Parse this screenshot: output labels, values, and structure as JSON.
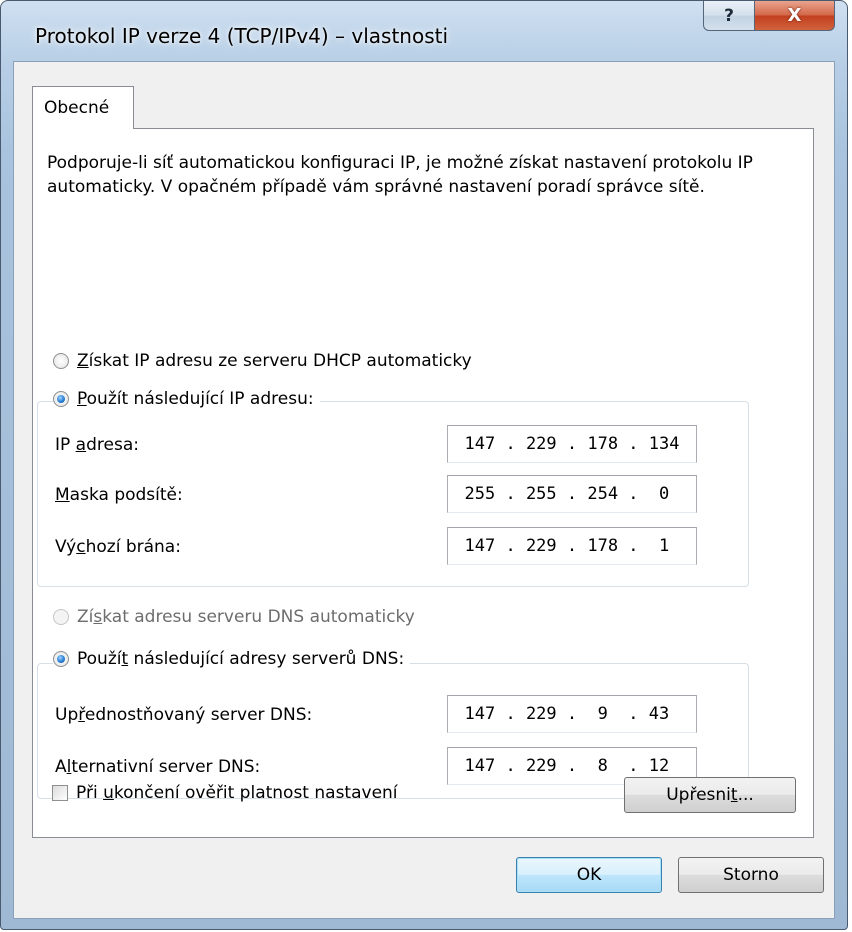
{
  "window": {
    "title": "Protokol IP verze 4 (TCP/IPv4) – vlastnosti",
    "help_glyph": "?",
    "close_glyph": "X"
  },
  "tabs": [
    {
      "label": "Obecné",
      "active": true
    }
  ],
  "description": "Podporuje-li síť automatickou konfiguraci IP, je možné získat nastavení protokolu IP automaticky. V opačném případě vám správné nastavení poradí správce sítě.",
  "ip_section": {
    "auto_radio": {
      "pre": "",
      "key": "Z",
      "post": "ískat IP adresu ze serveru DHCP automaticky",
      "checked": false
    },
    "manual_radio": {
      "pre": "",
      "key": "P",
      "post": "oužít následující IP adresu:",
      "checked": true
    },
    "fields": [
      {
        "label_pre": "IP ",
        "label_key": "a",
        "label_post": "dresa:",
        "value": "147 . 229 . 178 . 134"
      },
      {
        "label_pre": "",
        "label_key": "M",
        "label_post": "aska podsítě:",
        "value": "255 . 255 . 254 .  0 "
      },
      {
        "label_pre": "Vý",
        "label_key": "c",
        "label_post": "hozí brána:",
        "value": "147 . 229 . 178 .  1 "
      }
    ]
  },
  "dns_section": {
    "auto_radio": {
      "pre": "Zí",
      "key": "s",
      "post": "kat adresu serveru DNS automaticky",
      "checked": false,
      "disabled": true
    },
    "manual_radio": {
      "pre": "Použí",
      "key": "t",
      "post": " následující adresy serverů DNS:",
      "checked": true
    },
    "fields": [
      {
        "label_pre": "Up",
        "label_key": "ř",
        "label_post": "ednostňovaný server DNS:",
        "value": "147 . 229 .  9  . 43 "
      },
      {
        "label_pre": "A",
        "label_key": "l",
        "label_post": "ternativní server DNS:",
        "value": "147 . 229 .  8  . 12 "
      }
    ]
  },
  "validate_checkbox": {
    "pre": "Při ",
    "key": "u",
    "post": "končení ověřit platnost nastavení",
    "checked": false
  },
  "buttons": {
    "advanced": {
      "pre": "Upřesni",
      "key": "t",
      "post": "..."
    },
    "ok": "OK",
    "cancel": "Storno"
  }
}
